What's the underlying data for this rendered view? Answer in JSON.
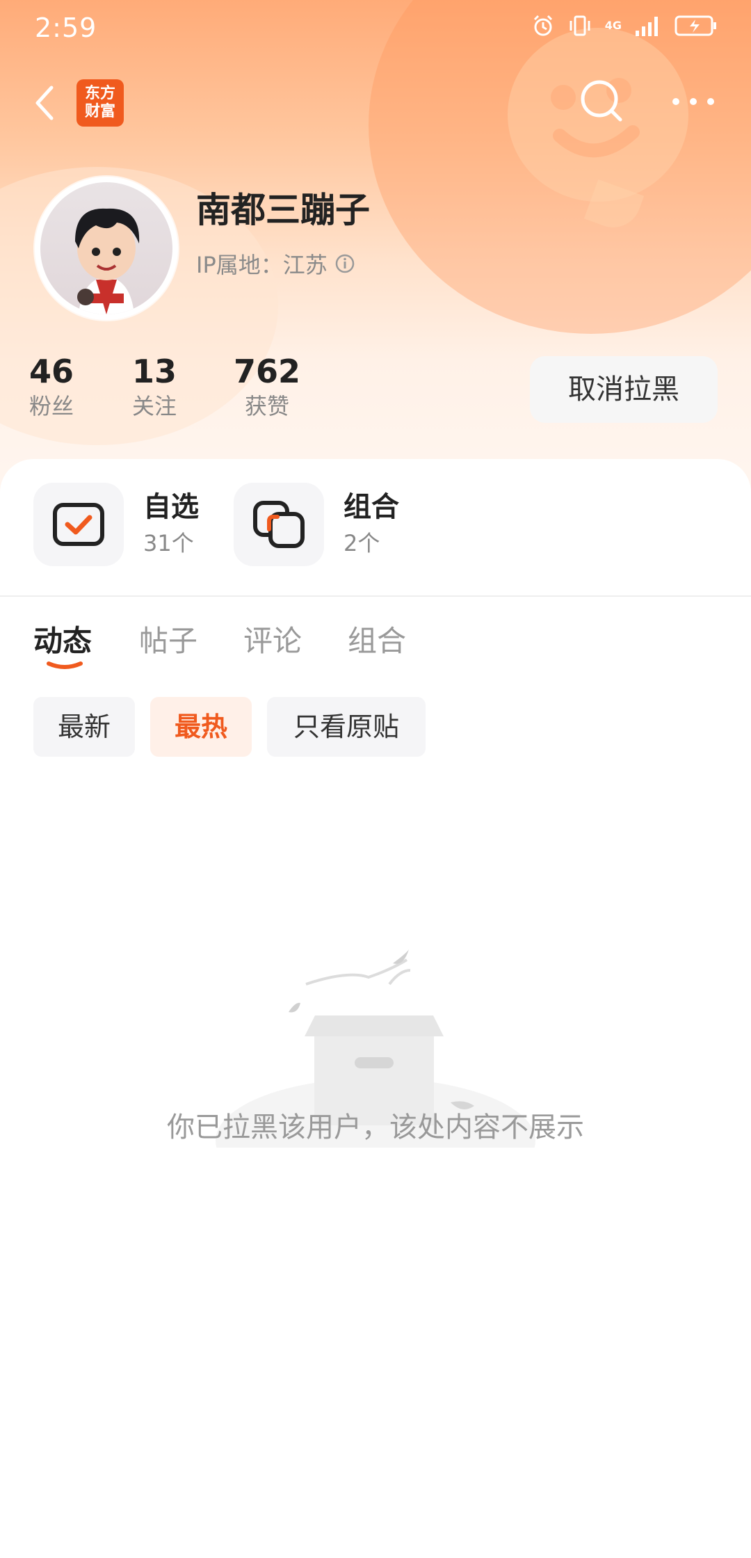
{
  "status_bar": {
    "time": "2:59",
    "network": "4G"
  },
  "nav": {
    "logo_line1": "东方",
    "logo_line2": "财富"
  },
  "profile": {
    "username": "南都三蹦子",
    "ip_location": "IP属地：江苏"
  },
  "stats": [
    {
      "value": "46",
      "label": "粉丝"
    },
    {
      "value": "13",
      "label": "关注"
    },
    {
      "value": "762",
      "label": "获赞"
    }
  ],
  "unblock_button": "取消拉黑",
  "shortcuts": [
    {
      "title": "自选",
      "count": "31个"
    },
    {
      "title": "组合",
      "count": "2个"
    }
  ],
  "tabs": [
    "动态",
    "帖子",
    "评论",
    "组合"
  ],
  "active_tab": "动态",
  "filters": [
    "最新",
    "最热",
    "只看原贴"
  ],
  "active_filter": "最热",
  "empty_message": "你已拉黑该用户，该处内容不展示",
  "colors": {
    "accent": "#f05a1e",
    "header_gradient_top": "#ffab78",
    "muted_text": "#999999"
  }
}
